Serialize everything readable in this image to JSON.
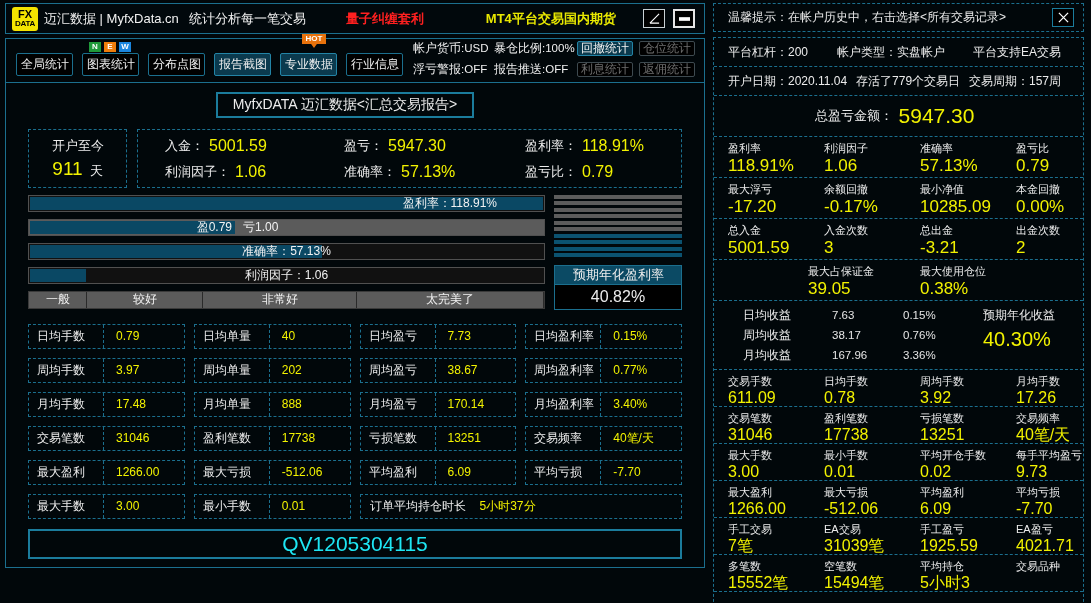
{
  "title_bar": {
    "logo": [
      "FX",
      "DATA"
    ],
    "title": "迈汇数据 | MyfxData.cn",
    "slogan": "统计分析每一笔交易",
    "promos": [
      {
        "text": "量子纠缠套利",
        "color": "#ff2020"
      },
      {
        "text": "MT4平台交易国内期货",
        "color": "#e8e800"
      }
    ]
  },
  "toolbar": {
    "tabs": [
      {
        "label": "全局统计",
        "selected": false
      },
      {
        "label": "图表统计",
        "selected": false,
        "badge": {
          "kind": "new",
          "letters": [
            {
              "text": "N",
              "color": "#1f9a3a"
            },
            {
              "text": "E",
              "color": "#ef7d0c"
            },
            {
              "text": "W",
              "color": "#1a86e0"
            }
          ]
        }
      },
      {
        "label": "分布点图",
        "selected": false
      },
      {
        "label": "报告截图",
        "selected": true
      },
      {
        "label": "专业数据",
        "selected": true,
        "badge": {
          "kind": "hot",
          "text": "HOT"
        }
      },
      {
        "label": "行业信息",
        "selected": false
      }
    ],
    "account_rows": [
      {
        "items": [
          "帐户货币:USD",
          "暴仓比例:100%"
        ],
        "buttons": [
          {
            "label": "回撤统计",
            "selected": true,
            "disabled": false
          },
          {
            "label": "仓位统计",
            "selected": false,
            "disabled": true
          }
        ]
      },
      {
        "items": [
          "浮亏警报:OFF",
          "报告推送:OFF"
        ],
        "buttons": [
          {
            "label": "利息统计",
            "selected": false,
            "disabled": true
          },
          {
            "label": "返佣统计",
            "selected": false,
            "disabled": true
          }
        ]
      }
    ]
  },
  "report": {
    "title": "MyfxDATA 迈汇数据<汇总交易报告>",
    "since_open": {
      "label": "开户至今",
      "value": "911",
      "unit": "天"
    },
    "summary": [
      {
        "label": "入金：",
        "value": "5001.59"
      },
      {
        "label": "盈亏：",
        "value": "5947.30"
      },
      {
        "label": "盈利率：",
        "value": "118.91%"
      },
      {
        "label": "利润因子：",
        "value": "1.06"
      },
      {
        "label": "准确率：",
        "value": "57.13%"
      },
      {
        "label": "盈亏比：",
        "value": "0.79"
      }
    ],
    "bars": [
      {
        "kind": "right",
        "label": "盈利率：118.91%",
        "level": 1
      },
      {
        "kind": "split",
        "win": "盈0.79",
        "loss": "亏1.00",
        "level": 0.4
      },
      {
        "kind": "center",
        "label": "准确率：57.13%",
        "level": 0.57
      },
      {
        "kind": "center",
        "label": "利润因子：1.06",
        "level": 0.11
      }
    ],
    "rating_scale": [
      "一般",
      "较好",
      "非常好",
      "太完美了"
    ],
    "annual": {
      "segments": [
        {
          "on": false
        },
        {
          "on": false
        },
        {
          "on": false
        },
        {
          "on": false
        },
        {
          "on": false
        },
        {
          "on": false
        },
        {
          "on": true
        },
        {
          "on": true
        },
        {
          "on": true
        },
        {
          "on": true
        }
      ],
      "label": "预期年化盈利率",
      "value": "40.82%"
    },
    "stats": [
      {
        "kind": "cell",
        "label": "日均手数",
        "value": "0.79"
      },
      {
        "kind": "cell",
        "label": "日均单量",
        "value": "40"
      },
      {
        "kind": "cell",
        "label": "日均盈亏",
        "value": "7.73"
      },
      {
        "kind": "cell",
        "label": "日均盈利率",
        "value": "0.15%"
      },
      {
        "kind": "cell",
        "label": "周均手数",
        "value": "3.97"
      },
      {
        "kind": "cell",
        "label": "周均单量",
        "value": "202"
      },
      {
        "kind": "cell",
        "label": "周均盈亏",
        "value": "38.67"
      },
      {
        "kind": "cell",
        "label": "周均盈利率",
        "value": "0.77%"
      },
      {
        "kind": "cell",
        "label": "月均手数",
        "value": "17.48"
      },
      {
        "kind": "cell",
        "label": "月均单量",
        "value": "888"
      },
      {
        "kind": "cell",
        "label": "月均盈亏",
        "value": "170.14"
      },
      {
        "kind": "cell",
        "label": "月均盈利率",
        "value": "3.40%"
      },
      {
        "kind": "cell",
        "label": "交易笔数",
        "value": "31046"
      },
      {
        "kind": "cell",
        "label": "盈利笔数",
        "value": "17738"
      },
      {
        "kind": "cell",
        "label": "亏损笔数",
        "value": "13251"
      },
      {
        "kind": "cell",
        "label": "交易频率",
        "value": "40笔/天"
      },
      {
        "kind": "cell",
        "label": "最大盈利",
        "value": "1266.00"
      },
      {
        "kind": "cell",
        "label": "最大亏损",
        "value": "-512.06"
      },
      {
        "kind": "cell",
        "label": "平均盈利",
        "value": "6.09"
      },
      {
        "kind": "cell",
        "label": "平均亏损",
        "value": "-7.70"
      },
      {
        "kind": "cell",
        "label": "最大手数",
        "value": "3.00"
      },
      {
        "kind": "cell",
        "label": "最小手数",
        "value": "0.01"
      },
      {
        "kind": "wide",
        "label": "订单平均持仓时长",
        "value": "5小时37分"
      }
    ],
    "account_id": "QV1205304115"
  },
  "side_panel": {
    "tip": "温馨提示：在帐户历史中，右击选择<所有交易记录>",
    "info_rows": [
      [
        "平台杠杆：200",
        "帐户类型：实盘帐户",
        "平台支持EA交易"
      ],
      [
        "开户日期：2020.11.04",
        "存活了779个交易日",
        "交易周期：157周"
      ]
    ],
    "total": {
      "label": "总盈亏金额：",
      "value": "5947.30"
    },
    "metric_rows": [
      [
        {
          "label": "盈利率",
          "value": "118.91%"
        },
        {
          "label": "利润因子",
          "value": "1.06"
        },
        {
          "label": "准确率",
          "value": "57.13%"
        },
        {
          "label": "盈亏比",
          "value": "0.79"
        }
      ],
      [
        {
          "label": "最大浮亏",
          "value": "-17.20"
        },
        {
          "label": "余额回撤",
          "value": "-0.17%"
        },
        {
          "label": "最小净值",
          "value": "10285.09"
        },
        {
          "label": "本金回撤",
          "value": "0.00%"
        }
      ],
      [
        {
          "label": "总入金",
          "value": "5001.59"
        },
        {
          "label": "入金次数",
          "value": "3"
        },
        {
          "label": "总出金",
          "value": "-3.21"
        },
        {
          "label": "出金次数",
          "value": "2"
        }
      ]
    ],
    "margin_row": [
      {
        "label": "最大占保证金",
        "value": "39.05"
      },
      {
        "label": "最大使用仓位",
        "value": "0.38%"
      }
    ],
    "returns": [
      {
        "label": "日均收益",
        "amount": "7.63",
        "rate": "0.15%"
      },
      {
        "label": "周均收益",
        "amount": "38.17",
        "rate": "0.76%"
      },
      {
        "label": "月均收益",
        "amount": "167.96",
        "rate": "3.36%"
      }
    ],
    "annual": {
      "label": "预期年化收益",
      "value": "40.30%"
    },
    "trade_rows": [
      [
        {
          "label": "交易手数",
          "value": "611.09"
        },
        {
          "label": "日均手数",
          "value": "0.78"
        },
        {
          "label": "周均手数",
          "value": "3.92"
        },
        {
          "label": "月均手数",
          "value": "17.26"
        }
      ],
      [
        {
          "label": "交易笔数",
          "value": "31046"
        },
        {
          "label": "盈利笔数",
          "value": "17738"
        },
        {
          "label": "亏损笔数",
          "value": "13251"
        },
        {
          "label": "交易频率",
          "value": "40笔/天"
        }
      ],
      [
        {
          "label": "最大手数",
          "value": "3.00"
        },
        {
          "label": "最小手数",
          "value": "0.01"
        },
        {
          "label": "平均开仓手数",
          "value": "0.02"
        },
        {
          "label": "每手平均盈亏",
          "value": "9.73"
        }
      ],
      [
        {
          "label": "最大盈利",
          "value": "1266.00"
        },
        {
          "label": "最大亏损",
          "value": "-512.06"
        },
        {
          "label": "平均盈利",
          "value": "6.09"
        },
        {
          "label": "平均亏损",
          "value": "-7.70"
        }
      ],
      [
        {
          "label": "手工交易",
          "value": "7笔"
        },
        {
          "label": "EA交易",
          "value": "31039笔"
        },
        {
          "label": "手工盈亏",
          "value": "1925.59"
        },
        {
          "label": "EA盈亏",
          "value": "4021.71"
        }
      ],
      [
        {
          "label": "多笔数",
          "value": "15552笔"
        },
        {
          "label": "空笔数",
          "value": "15494笔"
        },
        {
          "label": "平均持仓",
          "value": "5小时3"
        },
        {
          "label": "交易品种"
        }
      ]
    ]
  }
}
